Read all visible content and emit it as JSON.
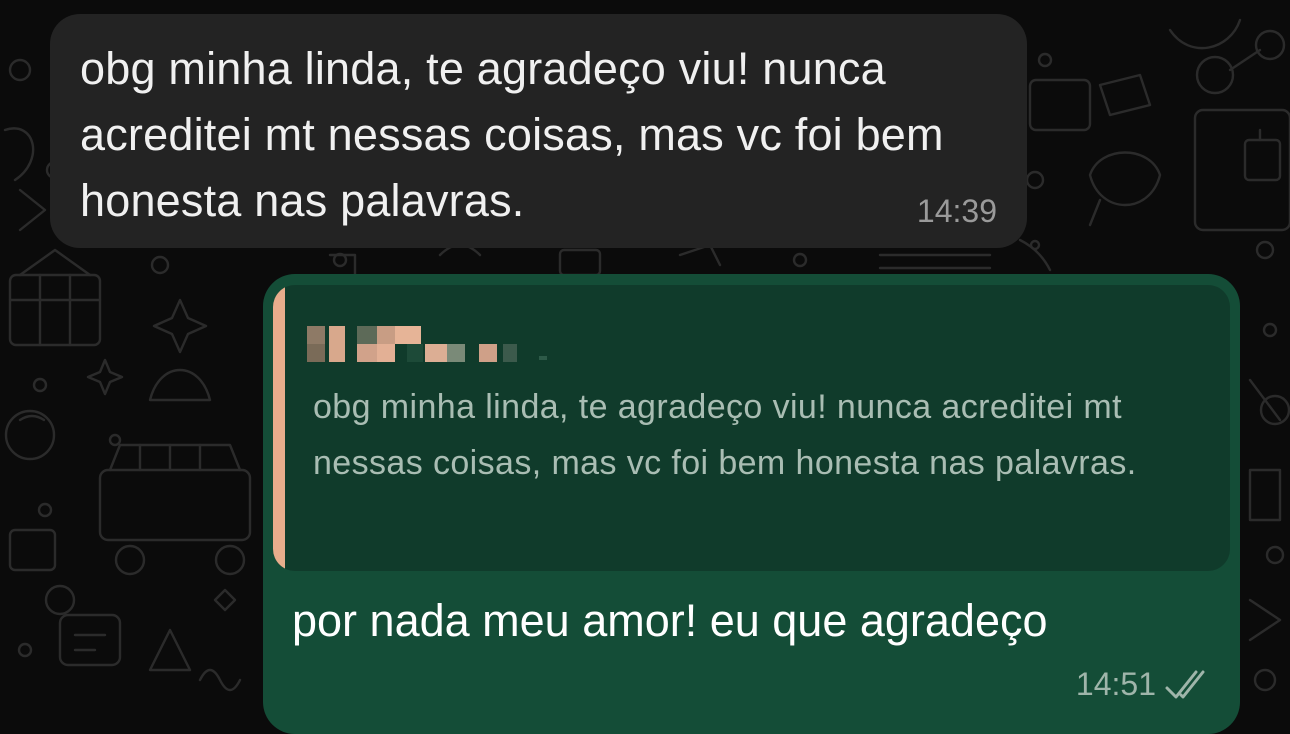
{
  "conversation": {
    "incoming": {
      "text": "obg minha linda, te agradeço viu! nunca acreditei mt nessas coisas, mas vc foi bem honesta nas palavras.",
      "time": "14:39"
    },
    "outgoing": {
      "reply_to": {
        "author_pixelated": true,
        "text": "obg minha linda, te agradeço viu! nunca acreditei mt nessas coisas, mas vc foi bem honesta nas palavras.",
        "accent_color": "#e8ad8c"
      },
      "text": "por nada meu amor! eu que agradeço",
      "time": "14:51",
      "status_icon": "double-check-icon"
    }
  },
  "colors": {
    "background": "#0b0b0b",
    "incoming_bubble": "#232323",
    "outgoing_bubble": "#144d37",
    "quote_background": "#103b2b"
  }
}
